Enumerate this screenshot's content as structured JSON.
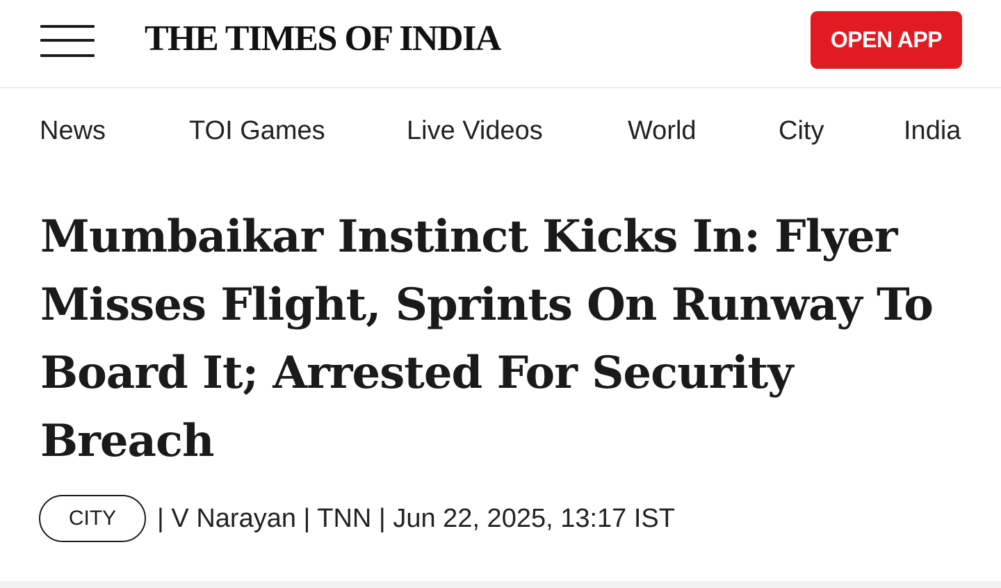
{
  "header": {
    "logo_text": "THE TIMES OF INDIA",
    "open_app_label": "OPEN APP",
    "menu_icon": "hamburger-menu-icon"
  },
  "nav": {
    "items": [
      "News",
      "TOI Games",
      "Live Videos",
      "World",
      "City",
      "India"
    ]
  },
  "article": {
    "headline": "Mumbaikar Instinct Kicks In: Flyer Misses Flight, Sprints On Runway To Board It; Arrested For Security Breach",
    "category": "CITY",
    "byline": "| V Narayan | TNN | Jun 22, 2025, 13:17 IST"
  },
  "colors": {
    "brand_red": "#e21b22",
    "text": "#1a1a1a"
  }
}
